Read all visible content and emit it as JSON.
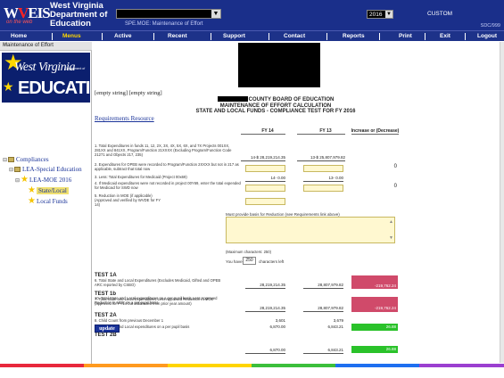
{
  "header": {
    "logo_w": "W",
    "logo_v": "V",
    "logo_eis": "EIS",
    "logo_sub": "on the web",
    "dept_line1": "West Virginia",
    "dept_line2": "Department of",
    "dept_line3": "Education",
    "app_title": "SPE.MOE: Maintenance of Effort",
    "year": "2016",
    "custom_label": "CUSTOM",
    "version": "SDC/999"
  },
  "nav": [
    {
      "label": "Home"
    },
    {
      "label": "Menus"
    },
    {
      "label": "Active"
    },
    {
      "label": "Recent"
    },
    {
      "label": "Support"
    },
    {
      "label": "Contact"
    },
    {
      "label": "Reports"
    },
    {
      "label": "Print"
    },
    {
      "label": "Exit"
    },
    {
      "label": "Logout"
    }
  ],
  "sidebar": {
    "title": "Maintenance of Effort",
    "close": "×",
    "banner_line1": "West Virginia",
    "banner_dept": "Department of",
    "banner_line2": "EDUCATION",
    "tree": {
      "root": "Compliances",
      "child": "LEA-Special Education",
      "grandchild": "LEA-MOE 2016",
      "leaf1": "State/Local",
      "leaf2": "Local Funds"
    }
  },
  "main": {
    "empty_strings": "[empty string] [empty string]",
    "cb_line1_suffix": "COUNTY BOARD OF EDUCATION",
    "cb_line2": "MAINTENANCE OF EFFORT CALCULATION",
    "cb_line3": "STATE AND LOCAL FUNDS - COMPLIANCE TEST FOR FY 2016",
    "requirements_link": "Requirements Resource",
    "col_fy14": "FY 14",
    "col_fy13": "FY 13",
    "col_change": "Increase or (Decrease)",
    "row1_desc": "1. Total Expenditures in funds 11, 12, 2X, 3X, 4X, 5X, 6X, and 7X Projects 001XX, 281XX and 841XX, Program/Function 21XXXX (Excluding Program/Function Code 21271 and Objects 217, 235)",
    "row1_fy14": "14-$ 28,219,214.35",
    "row1_fy13": "13-$ 25,807,979.82",
    "row2_desc": "2. Expenditures for OPEB were recorded to Program/Function 2XXXX but not in 217 as applicable, subtract that total now",
    "row2_change": "0",
    "row3_desc": "3. Less: Total Expenditures for Medicaid (Project 00x69)",
    "row3_fy14": "14- 0.00",
    "row3_fy13": "13- 0.00",
    "row4_desc": "4. If Medicaid expenditures were not recorded in project 00Y69, enter the total expended for Medicaid for SWD now",
    "row4_change": "0",
    "row5_desc": "5. Reduction in MOE (if applicable) (Approved and verified by WVDE for FY 14)",
    "reason_label": "Must provide basis for Reduction (see Requirements link above)",
    "max_chars": "(Maximum characters: 250)",
    "you_have": "You have",
    "chars_count": "250",
    "chars_left": "characters left",
    "test1a": "TEST 1A",
    "t6_desc": "6. Total State and Local Expenditures (Excludes Medicaid, Gifted and OPEB ARC reported by CSBO)",
    "t6_fy14": "28,219,214.35",
    "t6_fy13": "28,807,979.82",
    "t6_change": "-219,762.24",
    "test1b": "TEST 1b",
    "t7_desc": "7. Total State and Local Expenditures Less Approved Reduction in MOE (approved for FY14 but subtracted from prior year amount)",
    "t7_fy14": "28,219,214.35",
    "t7_fy13": "28,807,979.82",
    "t7_change": "-219,762.24",
    "test2a": "TEST 2A",
    "t8_desc": "8. Child Count from previous December 1",
    "t8_fy14": "3,601",
    "t8_fy13": "3,679",
    "t9_desc": "9. Total State and Local expenditures on a per pupil basis",
    "t9_fy14": "6,870.00",
    "t9_fy13": "6,843.21",
    "t9_change": "26.88",
    "test2b": "TEST 2B",
    "t10_desc": "10. Total State and Local expenditures on a per pupil basis Less Approved Reduction in MOE on a per pupil basis",
    "t10_fy14": "6,870.00",
    "t10_fy13": "6,843.21",
    "t10_change": "26.88",
    "update_label": "update"
  },
  "colors": {
    "header_bg": "#1a2f8a",
    "negative_change": "#d04a6a",
    "positive_change": "#2ac22a",
    "input_bg": "#fff8d0"
  }
}
